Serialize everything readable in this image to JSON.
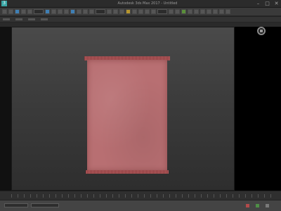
{
  "window": {
    "title": "Autodesk 3ds Max 2017 - Untitled"
  },
  "app": {
    "logo_letter": "3"
  },
  "window_controls": [
    "–",
    "□",
    "✕"
  ],
  "viewport": {
    "object": "rug"
  },
  "statusbar": {
    "icons": [
      "key-icon",
      "play-icon",
      "lock-icon"
    ]
  }
}
